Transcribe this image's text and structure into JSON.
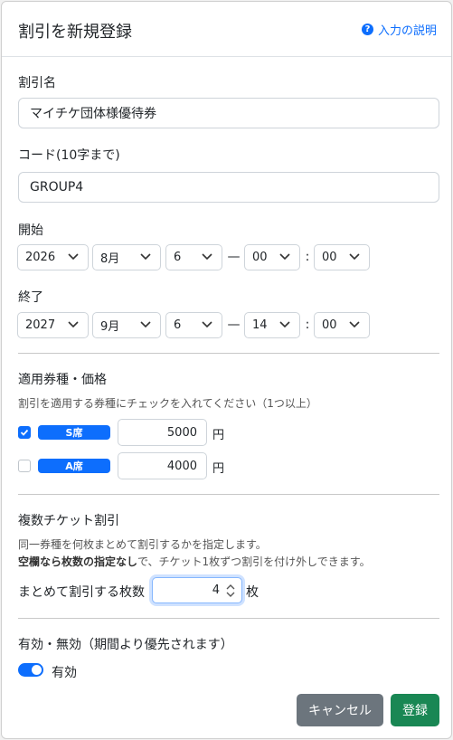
{
  "header": {
    "title": "割引を新規登録",
    "help_link": "入力の説明",
    "help_icon": "?"
  },
  "name_field": {
    "label": "割引名",
    "value": "マイチケ団体様優待券"
  },
  "code_field": {
    "label": "コード(10字まで)",
    "value": "GROUP4"
  },
  "start": {
    "label": "開始",
    "year": "2026",
    "month": "8月",
    "day": "6",
    "hour": "00",
    "minute": "00",
    "dash": "—",
    "colon": ":"
  },
  "end": {
    "label": "終了",
    "year": "2027",
    "month": "9月",
    "day": "6",
    "hour": "14",
    "minute": "00",
    "dash": "—",
    "colon": ":"
  },
  "ticket_types": {
    "title": "適用券種・価格",
    "description": "割引を適用する券種にチェックを入れてください（1つ以上）",
    "currency": "円",
    "items": [
      {
        "name": "S席",
        "price": "5000",
        "checked": true
      },
      {
        "name": "A席",
        "price": "4000",
        "checked": false
      }
    ]
  },
  "multi": {
    "title": "複数チケット割引",
    "desc1": "同一券種を何枚まとめて割引するかを指定します。",
    "desc2_bold": "空欄なら枚数の指定なし",
    "desc2_rest": "で、チケット1枚ずつ割引を付け外しできます。",
    "count_label": "まとめて割引する枚数",
    "count_value": "4",
    "count_unit": "枚"
  },
  "active": {
    "title": "有効・無効（期間より優先されます）",
    "toggle_label": "有効",
    "enabled": true
  },
  "footer": {
    "cancel_label": "キャンセル",
    "submit_label": "登録"
  },
  "colors": {
    "primary": "#0d6efd",
    "success": "#198754",
    "secondary": "#6c757d"
  }
}
